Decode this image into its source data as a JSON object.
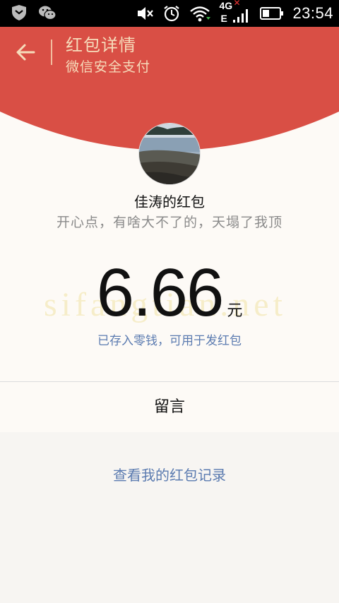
{
  "status_bar": {
    "time": "23:54",
    "network_label": "4G",
    "network_sub": "E"
  },
  "header": {
    "title": "红包详情",
    "subtitle": "微信安全支付",
    "bg_color": "#d94f45"
  },
  "red_packet": {
    "sender": "佳涛的红包",
    "wish": "开心点，有啥大不了的，天塌了我顶",
    "amount": "6.66",
    "currency": "元",
    "saved_note": "已存入零钱，可用于发红包",
    "watermark": "sifangtian.net"
  },
  "actions": {
    "message": "留言",
    "history": "查看我的红包记录"
  }
}
